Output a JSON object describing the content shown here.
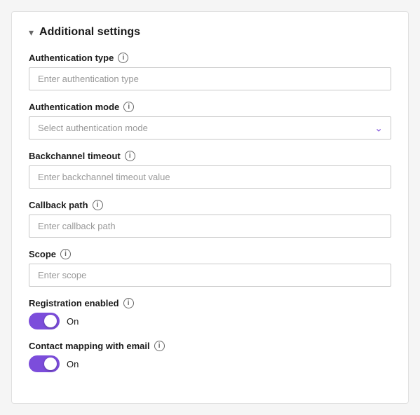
{
  "section": {
    "title": "Additional settings",
    "chevron": "▾"
  },
  "fields": {
    "authType": {
      "label": "Authentication type",
      "placeholder": "Enter authentication type"
    },
    "authMode": {
      "label": "Authentication mode",
      "placeholder": "Select authentication mode"
    },
    "backchannelTimeout": {
      "label": "Backchannel timeout",
      "placeholder": "Enter backchannel timeout value"
    },
    "callbackPath": {
      "label": "Callback path",
      "placeholder": "Enter callback path"
    },
    "scope": {
      "label": "Scope",
      "placeholder": "Enter scope"
    },
    "registrationEnabled": {
      "label": "Registration enabled",
      "toggleState": "On"
    },
    "contactMapping": {
      "label": "Contact mapping with email",
      "toggleState": "On"
    }
  }
}
